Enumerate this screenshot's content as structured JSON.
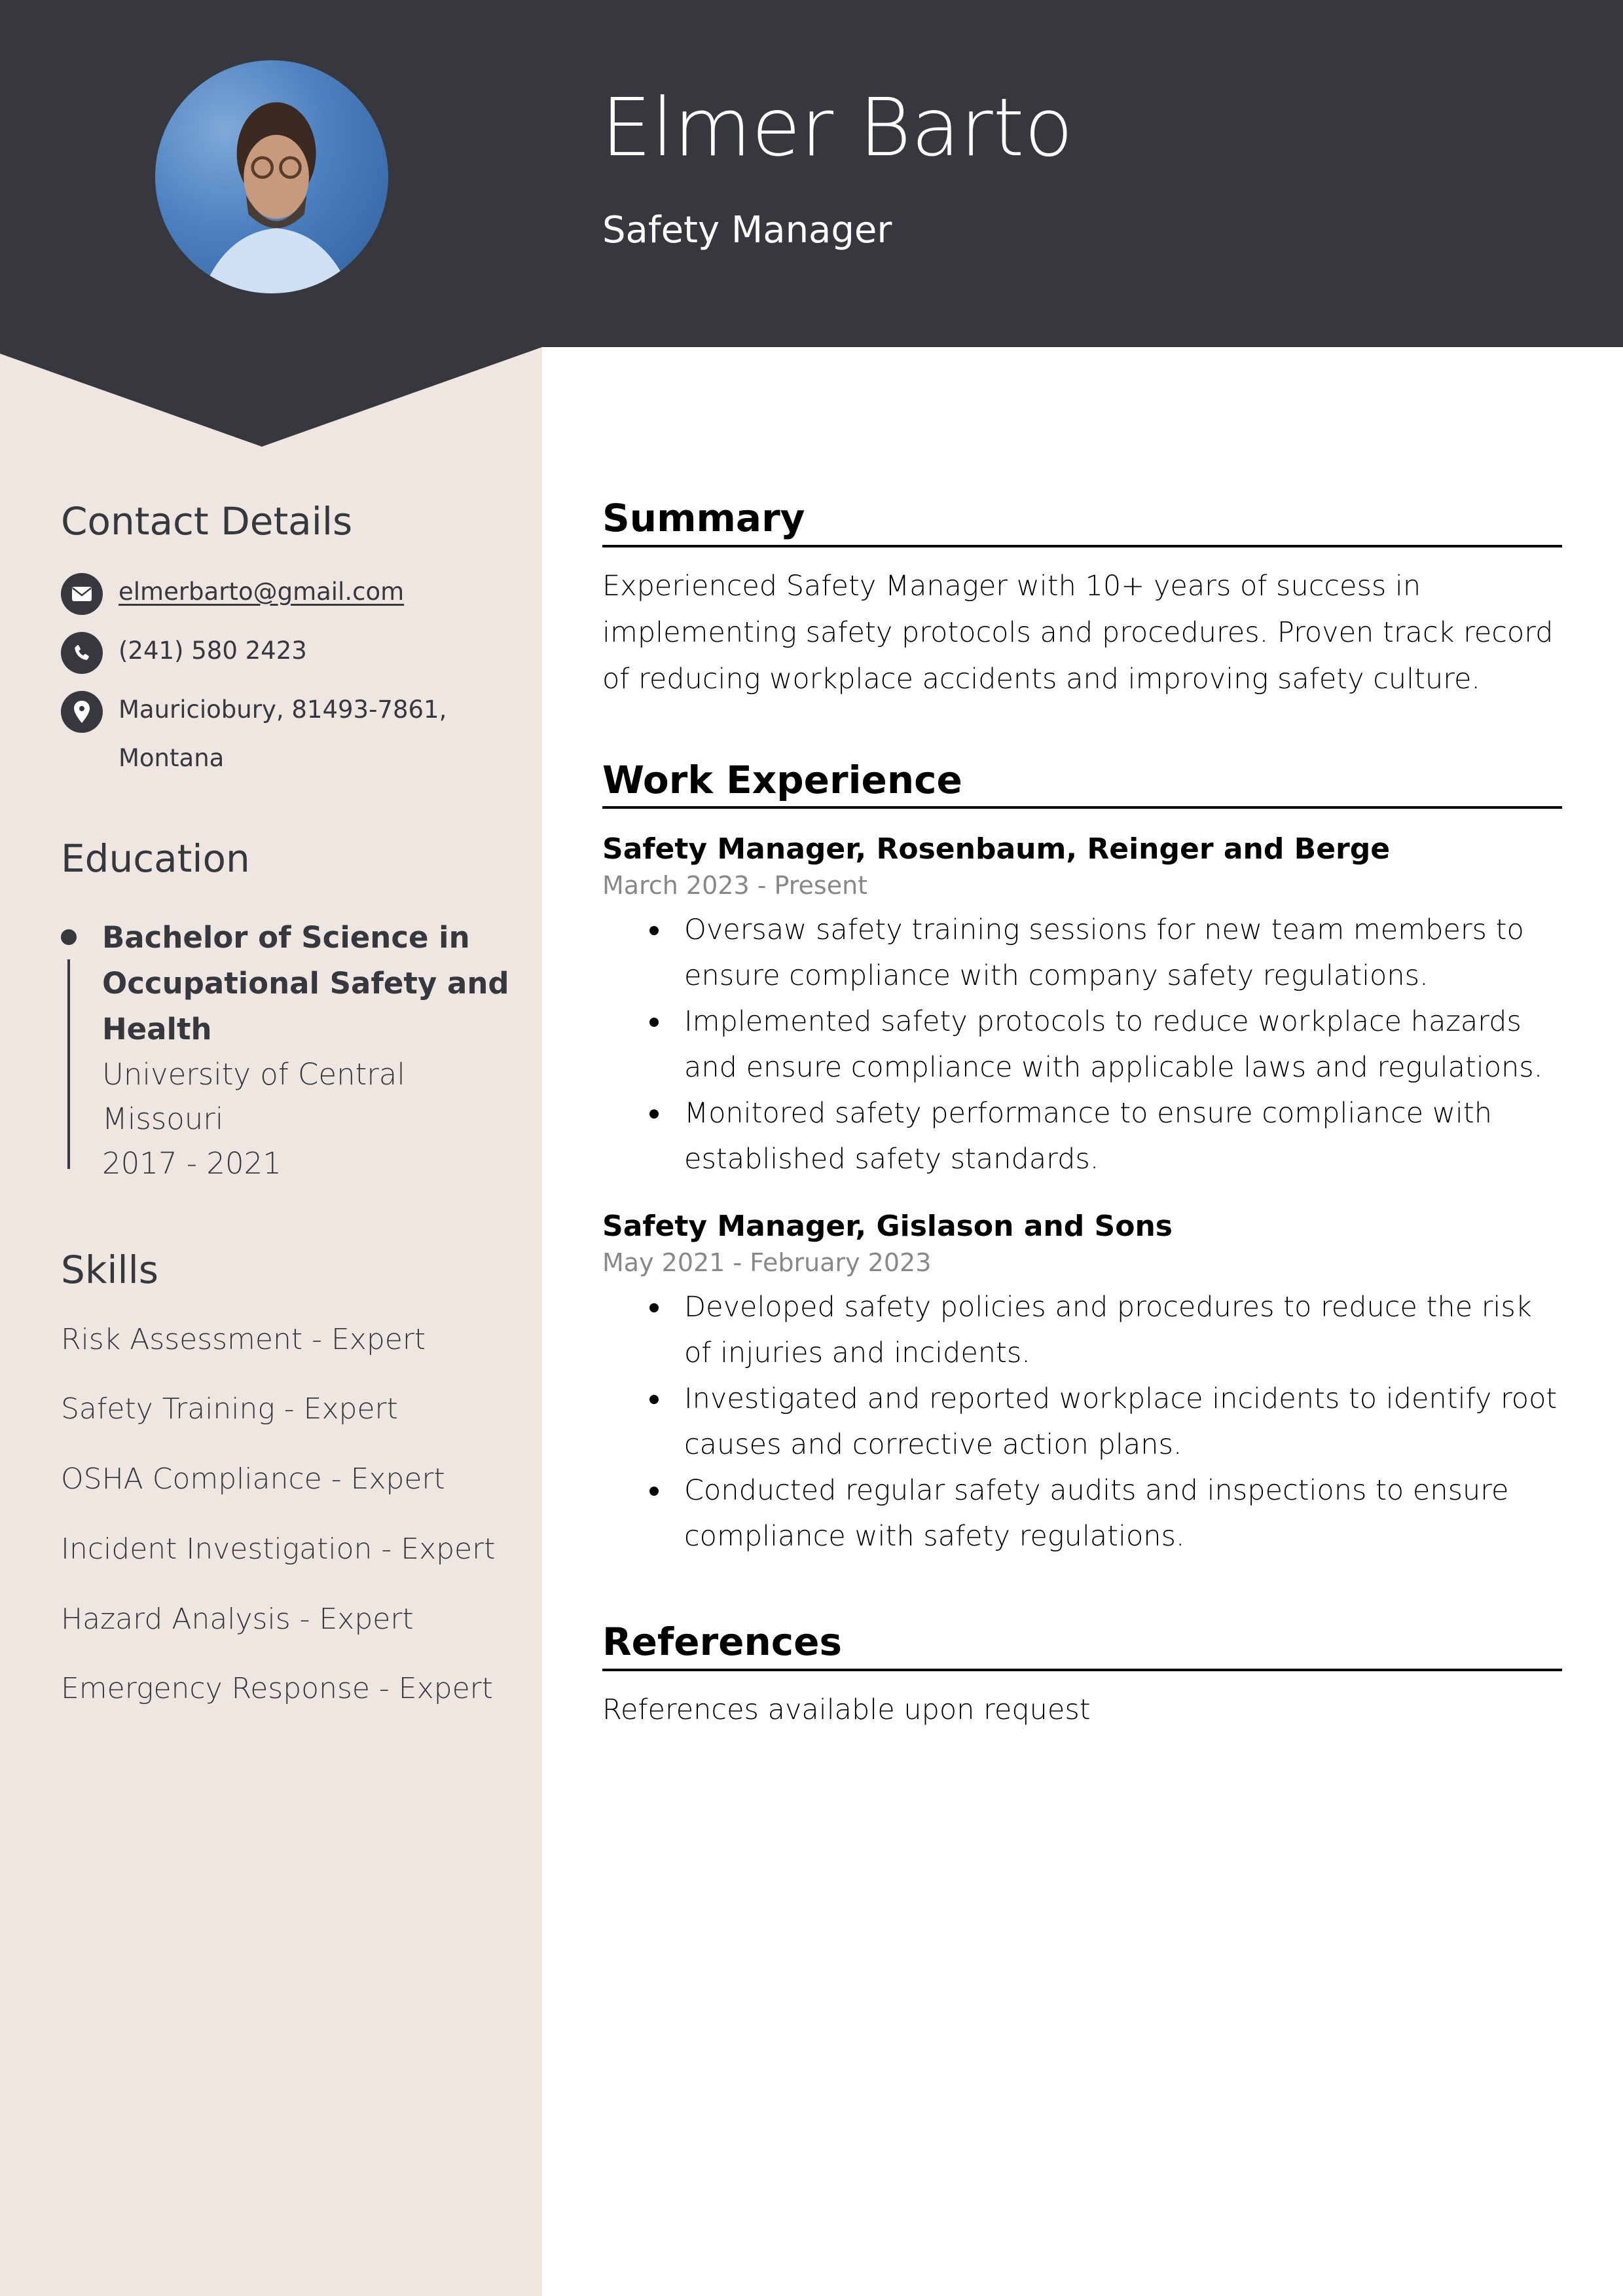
{
  "header": {
    "name": "Elmer Barto",
    "title": "Safety Manager",
    "photo_alt": "Profile photo"
  },
  "colors": {
    "header_bg": "#37383e",
    "sidebar_bg": "#ede6e1",
    "muted_text": "#888888"
  },
  "contact": {
    "heading": "Contact Details",
    "items": [
      {
        "icon": "envelope-icon",
        "text": "elmerbarto@gmail.com",
        "is_link": true
      },
      {
        "icon": "phone-icon",
        "text": "(241) 580 2423",
        "is_link": false
      },
      {
        "icon": "map-pin-icon",
        "text": "Mauriciobury, 81493-7861, Montana",
        "is_link": false
      }
    ]
  },
  "education": {
    "heading": "Education",
    "items": [
      {
        "degree": "Bachelor of Science in Occupational Safety and Health",
        "school": "University of Central Missouri",
        "years": "2017 - 2021"
      }
    ]
  },
  "skills": {
    "heading": "Skills",
    "items": [
      "Risk Assessment - Expert",
      "Safety Training - Expert",
      "OSHA Compliance - Expert",
      "Incident Investigation - Expert",
      "Hazard Analysis - Expert",
      "Emergency Response - Expert"
    ]
  },
  "summary": {
    "heading": "Summary",
    "text": "Experienced Safety Manager with 10+ years of success in implementing safety protocols and procedures. Proven track record of reducing workplace accidents and improving safety culture."
  },
  "experience": {
    "heading": "Work Experience",
    "jobs": [
      {
        "title": "Safety Manager, Rosenbaum, Reinger and Berge",
        "dates": "March 2023 - Present",
        "bullets": [
          "Oversaw safety training sessions for new team members to ensure compliance with company safety regulations.",
          "Implemented safety protocols to reduce workplace hazards and ensure compliance with applicable laws and regulations.",
          "Monitored safety performance to ensure compliance with established safety standards."
        ]
      },
      {
        "title": "Safety Manager, Gislason and Sons",
        "dates": "May 2021 - February 2023",
        "bullets": [
          "Developed safety policies and procedures to reduce the risk of injuries and incidents.",
          "Investigated and reported workplace incidents to identify root causes and corrective action plans.",
          "Conducted regular safety audits and inspections to ensure compliance with safety regulations."
        ]
      }
    ]
  },
  "references": {
    "heading": "References",
    "text": "References available upon request"
  }
}
